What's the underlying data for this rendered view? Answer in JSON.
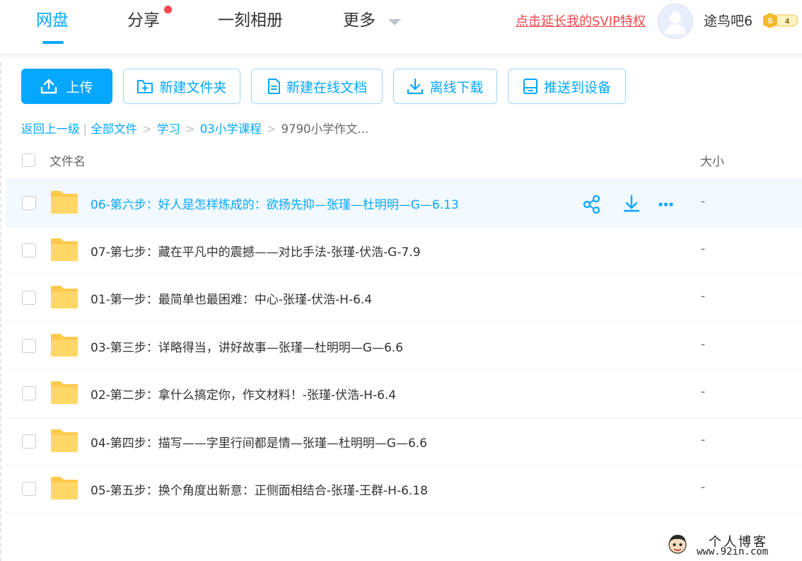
{
  "nav": {
    "tabs": [
      "网盘",
      "分享",
      "一刻相册",
      "更多"
    ],
    "svip_link": "点击延长我的SVIP特权",
    "username": "途鸟吧6",
    "vip_level": "4",
    "vip_symbol": "S"
  },
  "toolbar": {
    "upload": "上传",
    "new_folder": "新建文件夹",
    "new_doc": "新建在线文档",
    "offline_download": "离线下载",
    "push_device": "推送到设备"
  },
  "breadcrumb": {
    "back": "返回上一级",
    "separator": "|",
    "arrow": ">",
    "items": [
      "全部文件",
      "学习",
      "03小学课程"
    ],
    "current": "9790小学作文..."
  },
  "table": {
    "col_name": "文件名",
    "col_size": "大小",
    "rows": [
      {
        "name": "06-第六步：好人是怎样炼成的：欲扬先抑—张瑾—杜明明—G—6.13",
        "size": "-"
      },
      {
        "name": "07-第七步：藏在平凡中的震撼——对比手法-张瑾-伏浩-G-7.9",
        "size": "-"
      },
      {
        "name": "01-第一步：最简单也最困难：中心-张瑾-伏浩-H-6.4",
        "size": "-"
      },
      {
        "name": "03-第三步：详略得当，讲好故事—张瑾—杜明明—G—6.6",
        "size": "-"
      },
      {
        "name": "02-第二步：拿什么搞定你，作文材料！-张瑾-伏浩-H-6.4",
        "size": "-"
      },
      {
        "name": "04-第四步：描写——字里行间都是情—张瑾—杜明明—G—6.6",
        "size": "-"
      },
      {
        "name": "05-第五步：换个角度出新意：正侧面相结合-张瑾-王群-H-6.18",
        "size": "-"
      }
    ]
  },
  "watermark": {
    "title": "个人博客",
    "url": "www.92in.com"
  },
  "colors": {
    "accent": "#06a7ff",
    "alert": "#f5464c",
    "folder": "#ffd25a"
  }
}
